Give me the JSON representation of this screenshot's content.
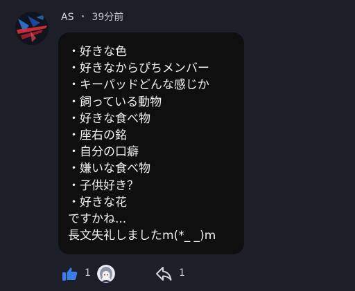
{
  "comment": {
    "author": "AS",
    "separator": "・",
    "time_ago": "39分前",
    "lines": [
      "・好きな色",
      "・好きなからぴちメンバー",
      "・キーパッドどんな感じか",
      "・飼っている動物",
      "・好きな食べ物",
      "・座右の銘",
      "・自分の口癖",
      "・嫌いな食べ物",
      "・子供好き？",
      "・好きな花",
      "ですかね...",
      "長文失礼しましたm(*_ _)m"
    ]
  },
  "actions": {
    "like_icon": "thumbs-up-icon",
    "like_count": "1",
    "reply_icon": "reply-arrow-icon",
    "reply_count": "1"
  },
  "colors": {
    "background": "#1c1f28",
    "bubble": "#0f0f10",
    "like_blue": "#3b7ded"
  }
}
